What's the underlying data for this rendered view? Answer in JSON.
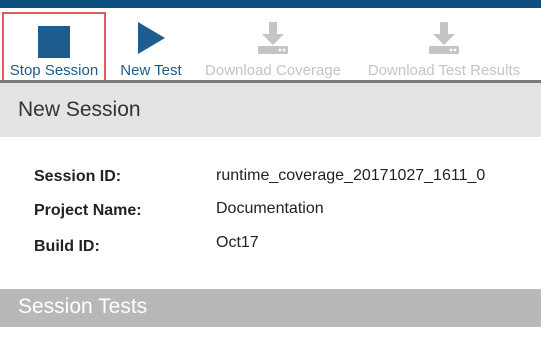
{
  "toolbar": {
    "stop_session": "Stop Session",
    "new_test": "New Test",
    "download_coverage": "Download Coverage",
    "download_test_results": "Download Test Results"
  },
  "session_section": {
    "title": "New Session",
    "rows": [
      {
        "label": "Session ID:",
        "value": "runtime_coverage_20171027_1611_0"
      },
      {
        "label": "Project Name:",
        "value": "Documentation"
      },
      {
        "label": "Build ID:",
        "value": "Oct17"
      }
    ]
  },
  "tests_section": {
    "title": "Session Tests"
  },
  "colors": {
    "accent": "#1d5c8c",
    "topbar": "#0d4f7d",
    "highlight": "#e05a5f",
    "disabled": "#c4c4c4"
  }
}
